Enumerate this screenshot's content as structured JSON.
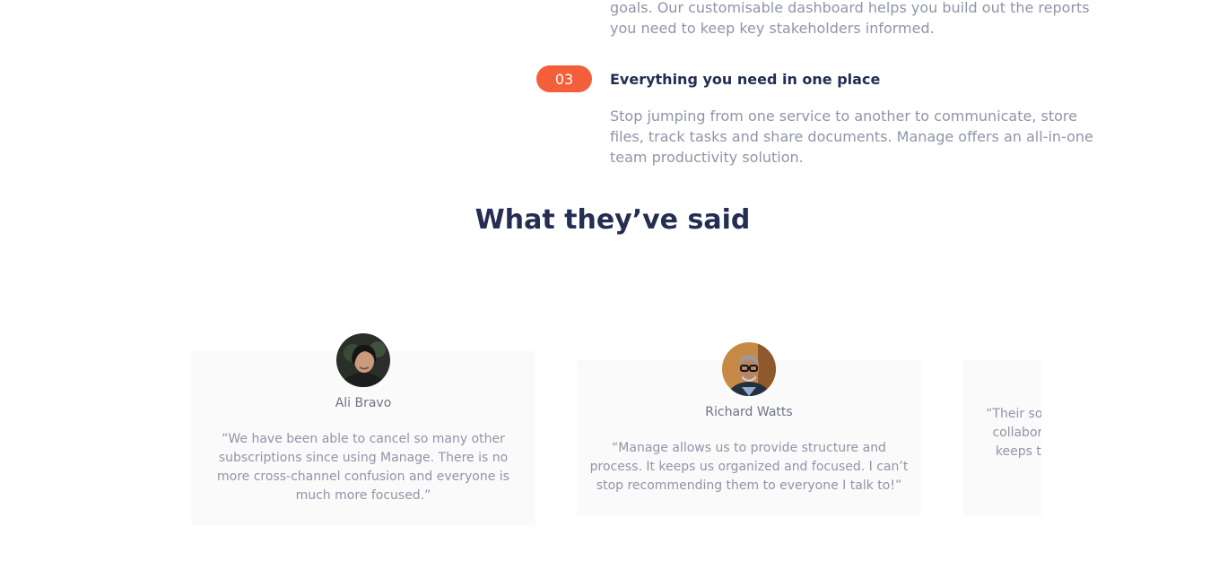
{
  "features": {
    "top_text": "goals. Our customisable dashboard helps you build out the reports you need to keep key stakeholders informed.",
    "item3": {
      "number": "03",
      "title": "Everything you need in one place",
      "description": "Stop jumping from one service to another to communicate, store files, track tasks and share documents. Manage offers an all-in-one team productivity solution."
    }
  },
  "testimonials": {
    "title": "What they’ve said",
    "items": [
      {
        "name": "Ali Bravo",
        "quote": "“We have been able to cancel so many other subscriptions since using Manage. There is no more cross-channel confusion and everyone is much more focused.”"
      },
      {
        "name": "Richard Watts",
        "quote": "“Manage allows us to provide structure and process. It keeps us organized and focused. I can’t stop recommending them to everyone I talk to!”"
      },
      {
        "name": "",
        "quote": "“Their software allows us to track, manage and collaborate on our projects from anywhere. It keeps the whole team in-sync without being intrusive.”"
      }
    ]
  },
  "colors": {
    "accent": "#f25f3a",
    "heading": "#242d52",
    "body": "#9095a7",
    "card_bg": "#fafafa"
  }
}
